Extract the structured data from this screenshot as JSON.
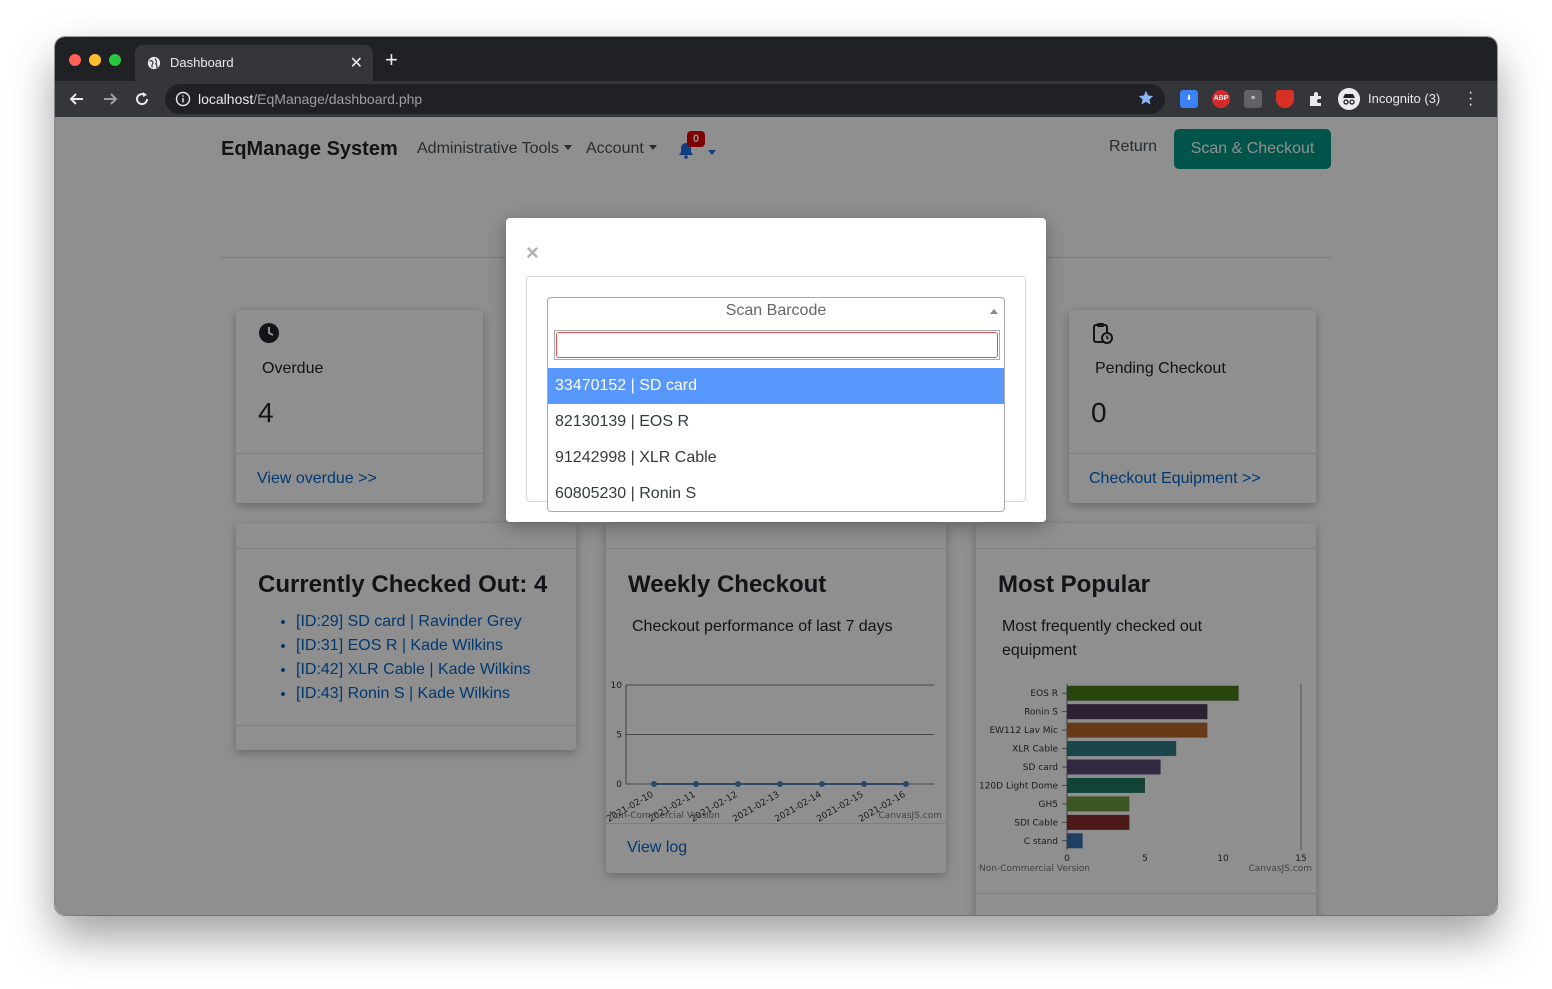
{
  "browser": {
    "tab_title": "Dashboard",
    "url_host": "localhost",
    "url_path": "/EqManage/dashboard.php",
    "profile_label": "Incognito (3)",
    "extensions": [
      {
        "name": "download-extension-icon",
        "text": "",
        "color": "#3b82f6"
      },
      {
        "name": "adblock-icon",
        "text": "ABP",
        "color": "#d42a2a"
      },
      {
        "name": "reader-extension-icon",
        "text": "",
        "color": "#5f6368"
      },
      {
        "name": "shield-extension-icon",
        "text": "",
        "color": "#d93025"
      },
      {
        "name": "puzzle-extensions-icon",
        "text": "",
        "color": "#35363a"
      }
    ]
  },
  "navbar": {
    "brand": "EqManage System",
    "admin_tools": "Administrative Tools",
    "account": "Account",
    "notification_count": "0",
    "return": "Return",
    "scan_checkout": "Scan & Checkout"
  },
  "cards": {
    "overdue": {
      "label": "Overdue",
      "value": "4",
      "link": "View overdue >>"
    },
    "pending": {
      "label": "Pending Checkout",
      "value": "0",
      "link": "Checkout Equipment >>"
    },
    "checked_out": {
      "title": "Currently Checked Out: 4",
      "items": [
        "[ID:29] SD card | Ravinder Grey",
        "[ID:31] EOS R | Kade Wilkins",
        "[ID:42] XLR Cable | Kade Wilkins",
        "[ID:43] Ronin S | Kade Wilkins"
      ]
    },
    "weekly": {
      "title": "Weekly Checkout",
      "subtitle": "Checkout performance of last 7 days",
      "link": "View log",
      "watermark_left": "Non-Commercial Version",
      "watermark_right": "CanvasJS.com"
    },
    "popular": {
      "title": "Most Popular",
      "subtitle_line1": "Most frequently checked out",
      "subtitle_line2": "equipment",
      "watermark_left": "Non-Commercial Version",
      "watermark_right": "CanvasJS.com"
    }
  },
  "modal": {
    "close": "×",
    "select_placeholder": "Scan Barcode",
    "search_value": "",
    "options": [
      "33470152 | SD card",
      "82130139 | EOS R",
      "91242998 | XLR Cable",
      "60805230 | Ronin S"
    ],
    "active_index": 0
  },
  "chart_data": [
    {
      "type": "line",
      "x": [
        "2021-02-10",
        "2021-02-11",
        "2021-02-12",
        "2021-02-13",
        "2021-02-14",
        "2021-02-15",
        "2021-02-16"
      ],
      "series": [
        {
          "values": [
            0,
            0,
            0,
            0,
            0,
            0,
            0
          ]
        }
      ],
      "ylim": [
        0,
        10
      ],
      "yticks": [
        0,
        5,
        10
      ],
      "grid": true,
      "color": "#4f81bc"
    },
    {
      "type": "bar",
      "orientation": "horizontal",
      "categories": [
        "EOS R",
        "Ronin S",
        "EW112 Lav Mic",
        "XLR Cable",
        "SD card",
        "120D Light Dome",
        "GH5",
        "SDI Cable",
        "C stand"
      ],
      "values": [
        11,
        9,
        9,
        7,
        6,
        5,
        4,
        4,
        1
      ],
      "colors": [
        "#4a7c1a",
        "#4f3b57",
        "#b86a2a",
        "#2f7d86",
        "#5a4a78",
        "#1f7a63",
        "#6c9a3c",
        "#8a2f2f",
        "#3c6fb4"
      ],
      "xlim": [
        0,
        15
      ],
      "xticks": [
        0,
        5,
        10,
        15
      ]
    }
  ]
}
